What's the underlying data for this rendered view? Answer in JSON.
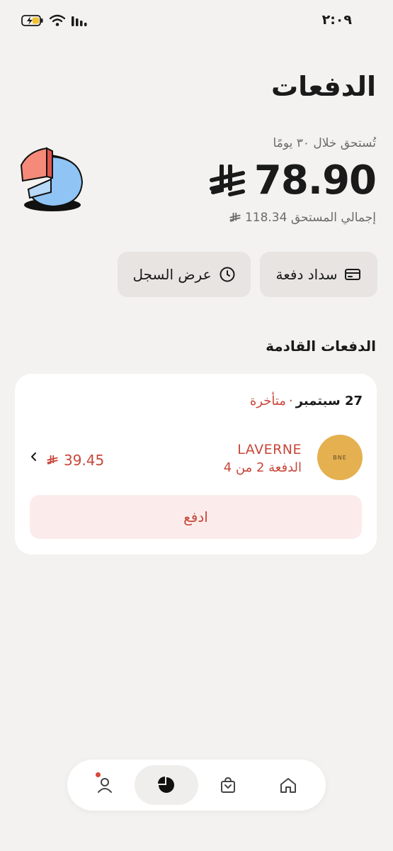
{
  "status_bar": {
    "time": "٢:٠٩"
  },
  "header": {
    "title": "الدفعات"
  },
  "summary": {
    "due_label": "تُستحق خلال ٣٠ يومًا",
    "amount": "78.90",
    "total_label": "إجمالي المستحق 118.34"
  },
  "actions": {
    "pay_installment": "سداد دفعة",
    "view_history": "عرض السجل"
  },
  "upcoming": {
    "section_title": "الدفعات القادمة",
    "card": {
      "date": "27 سبتمبر",
      "separator": "·",
      "status": "متأخرة",
      "merchant_name": "LAVERNE",
      "merchant_logo_text": "BNE",
      "installment": "الدفعة 2 من 4",
      "amount": "39.45",
      "pay_button": "ادفع"
    }
  },
  "bottom_nav": {
    "items": [
      {
        "icon": "profile-icon",
        "has_notification": true
      },
      {
        "icon": "pie-chart-icon",
        "active": true
      },
      {
        "icon": "shopping-bag-icon"
      },
      {
        "icon": "home-icon"
      }
    ]
  },
  "colors": {
    "accent_red": "#c8473a",
    "background": "#f3f2f1",
    "card": "#ffffff"
  }
}
